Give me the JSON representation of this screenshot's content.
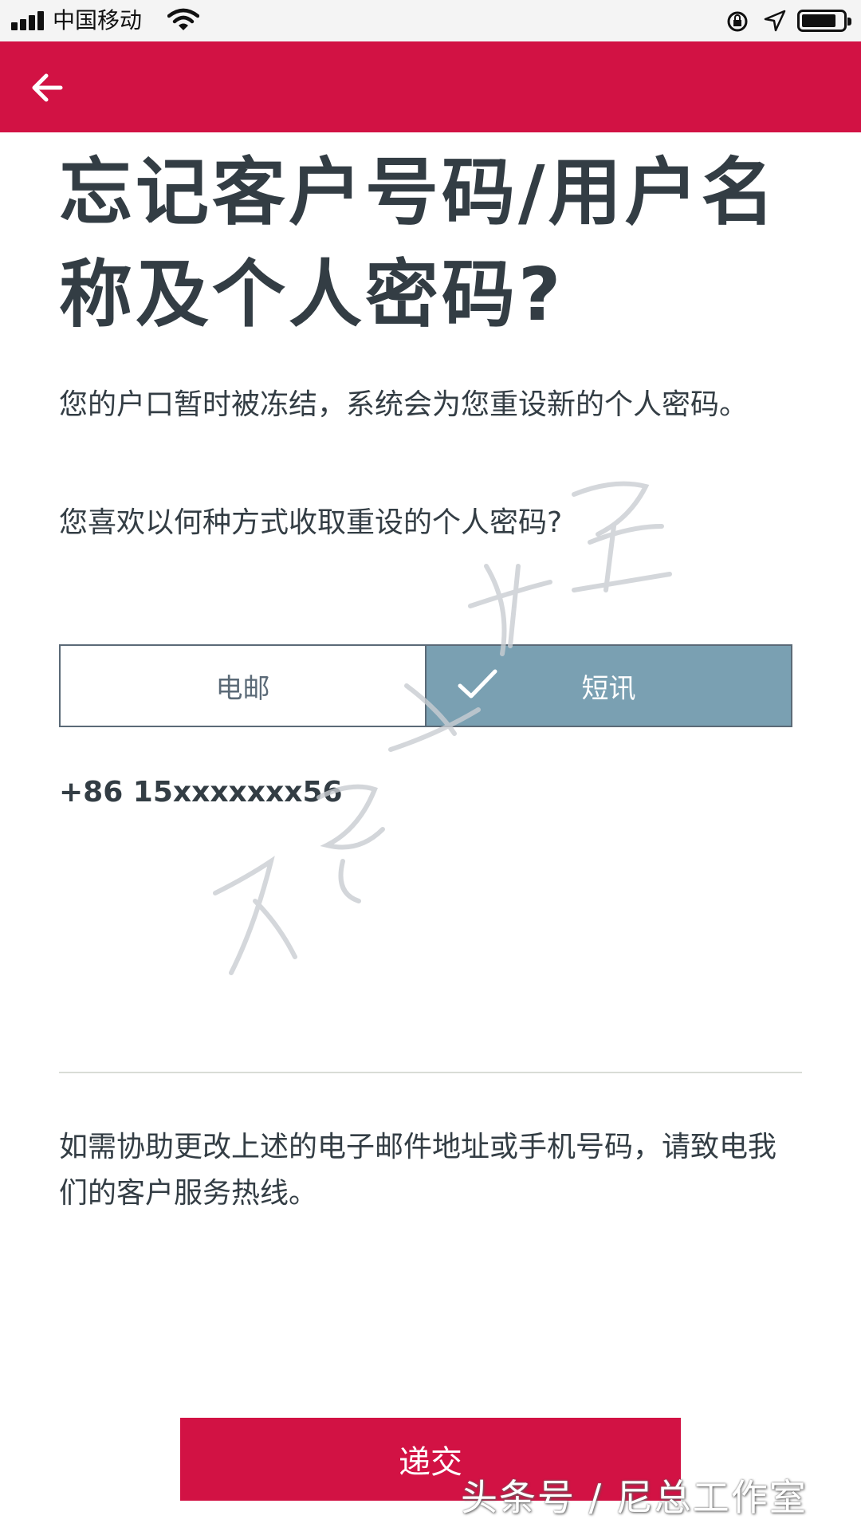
{
  "status_bar": {
    "carrier": "中国移动"
  },
  "header": {
    "back_icon": "arrow-left-icon",
    "color": "#d21244"
  },
  "page": {
    "title": "忘记客户号码/用户名称及个人密码?",
    "description": "您的户口暂时被冻结，系统会为您重设新的个人密码。",
    "question": "您喜欢以何种方式收取重设的个人密码?"
  },
  "method_selector": {
    "options": [
      {
        "label": "电邮",
        "selected": false
      },
      {
        "label": "短讯",
        "selected": true
      }
    ],
    "selected_color": "#7aa0b2"
  },
  "phone_number": "+86 15xxxxxxx56",
  "help_text": "如需协助更改上述的电子邮件地址或手机号码，请致电我们的客户服务热线。",
  "submit_label": "递交",
  "watermark": "头条号 / 尼总工作室"
}
